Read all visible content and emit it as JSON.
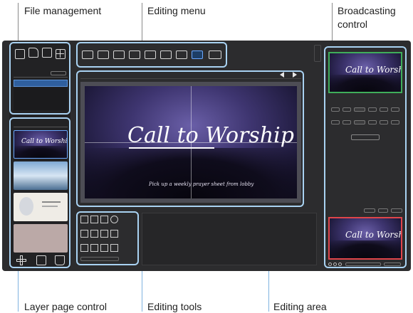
{
  "callouts": {
    "file_management": "File management",
    "editing_menu": "Editing menu",
    "broadcasting_line1": "Broadcasting",
    "broadcasting_line2": "control",
    "layer_page_control": "Layer page control",
    "editing_tools": "Editing tools",
    "editing_area": "Editing area"
  },
  "canvas": {
    "title": "Call to Worship",
    "subtitle": "Pick up a weekly prayer sheet from lobby"
  },
  "preview": {
    "title": "Call to Worship"
  },
  "output": {
    "title": "Call to Worship"
  },
  "colors": {
    "highlight": "#a9d2f2",
    "accent_blue": "#6aa8ff",
    "preview_border": "#3fae5a",
    "output_border": "#e0454a",
    "app_background": "#2c2c2e"
  },
  "icons": {
    "file_tools": [
      "new-file-icon",
      "open-file-icon",
      "save-file-icon",
      "grid-layout-icon"
    ],
    "editing_menu": [
      "camera-icon",
      "video-icon",
      "youtube-icon",
      "subtitle-icon",
      "bible-icon",
      "song-icon",
      "text-icon",
      "image-icon",
      "broadcast-icon"
    ],
    "layer_controls": [
      "add-layer-icon",
      "copy-layer-icon",
      "delete-layer-icon"
    ],
    "editing_tools": [
      "pen-icon",
      "line-icon",
      "rectangle-icon",
      "circle-icon",
      "image-tool-icon",
      "layer-tool-icon",
      "front-icon",
      "back-icon",
      "align-icon",
      "distribute-icon",
      "resize-icon",
      "group-icon"
    ]
  }
}
